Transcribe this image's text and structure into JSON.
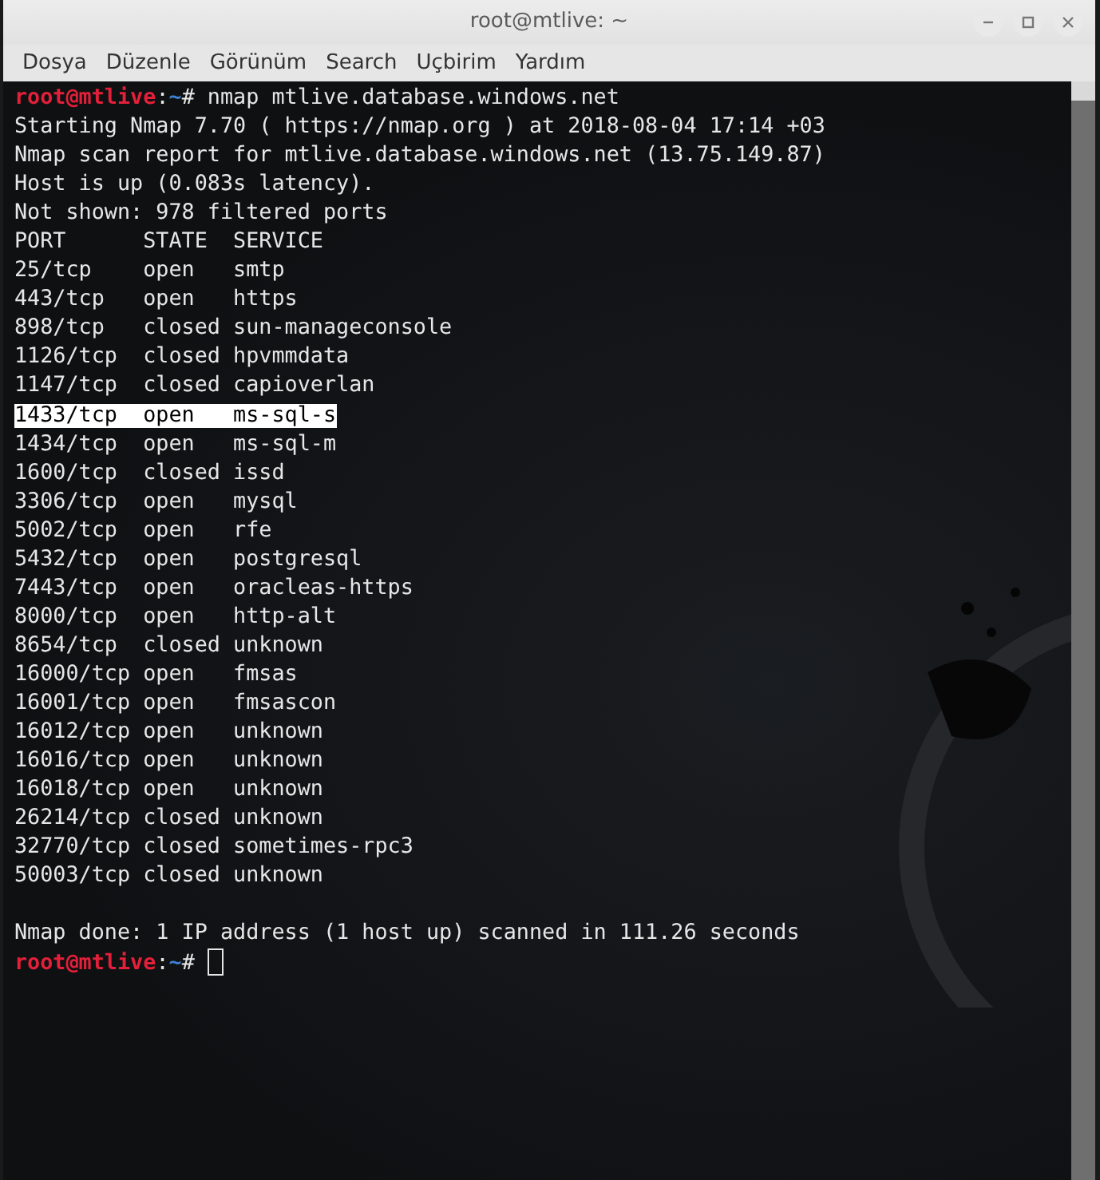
{
  "window": {
    "title": "root@mtlive: ~"
  },
  "menu": [
    "Dosya",
    "Düzenle",
    "Görünüm",
    "Search",
    "Uçbirim",
    "Yardım"
  ],
  "terminal": {
    "lines": [
      {
        "kind": "prompt",
        "user": "root@mtlive",
        "separator": ":",
        "path": "~",
        "symbol": "#",
        "command": "nmap mtlive.database.windows.net",
        "selected": false
      },
      {
        "kind": "text",
        "text": "Starting Nmap 7.70 ( https://nmap.org ) at 2018-08-04 17:14 +03",
        "selected": false
      },
      {
        "kind": "text",
        "text": "Nmap scan report for mtlive.database.windows.net (13.75.149.87)",
        "selected": false
      },
      {
        "kind": "text",
        "text": "Host is up (0.083s latency).",
        "selected": false
      },
      {
        "kind": "text",
        "text": "Not shown: 978 filtered ports",
        "selected": false
      },
      {
        "kind": "text",
        "text": "PORT      STATE  SERVICE",
        "selected": false
      },
      {
        "kind": "text",
        "text": "25/tcp    open   smtp",
        "selected": false
      },
      {
        "kind": "text",
        "text": "443/tcp   open   https",
        "selected": false
      },
      {
        "kind": "text",
        "text": "898/tcp   closed sun-manageconsole",
        "selected": false
      },
      {
        "kind": "text",
        "text": "1126/tcp  closed hpvmmdata",
        "selected": false
      },
      {
        "kind": "text",
        "text": "1147/tcp  closed capioverlan",
        "selected": false
      },
      {
        "kind": "text",
        "text": "1433/tcp  open   ms-sql-s",
        "selected": true
      },
      {
        "kind": "text",
        "text": "1434/tcp  open   ms-sql-m",
        "selected": false
      },
      {
        "kind": "text",
        "text": "1600/tcp  closed issd",
        "selected": false
      },
      {
        "kind": "text",
        "text": "3306/tcp  open   mysql",
        "selected": false
      },
      {
        "kind": "text",
        "text": "5002/tcp  open   rfe",
        "selected": false
      },
      {
        "kind": "text",
        "text": "5432/tcp  open   postgresql",
        "selected": false
      },
      {
        "kind": "text",
        "text": "7443/tcp  open   oracleas-https",
        "selected": false
      },
      {
        "kind": "text",
        "text": "8000/tcp  open   http-alt",
        "selected": false
      },
      {
        "kind": "text",
        "text": "8654/tcp  closed unknown",
        "selected": false
      },
      {
        "kind": "text",
        "text": "16000/tcp open   fmsas",
        "selected": false
      },
      {
        "kind": "text",
        "text": "16001/tcp open   fmsascon",
        "selected": false
      },
      {
        "kind": "text",
        "text": "16012/tcp open   unknown",
        "selected": false
      },
      {
        "kind": "text",
        "text": "16016/tcp open   unknown",
        "selected": false
      },
      {
        "kind": "text",
        "text": "16018/tcp open   unknown",
        "selected": false
      },
      {
        "kind": "text",
        "text": "26214/tcp closed unknown",
        "selected": false
      },
      {
        "kind": "text",
        "text": "32770/tcp closed sometimes-rpc3",
        "selected": false
      },
      {
        "kind": "text",
        "text": "50003/tcp closed unknown",
        "selected": false
      },
      {
        "kind": "blank"
      },
      {
        "kind": "text",
        "text": "Nmap done: 1 IP address (1 host up) scanned in 111.26 seconds",
        "selected": false
      },
      {
        "kind": "prompt",
        "user": "root@mtlive",
        "separator": ":",
        "path": "~",
        "symbol": "#",
        "cursor": true,
        "selected": false
      }
    ]
  }
}
